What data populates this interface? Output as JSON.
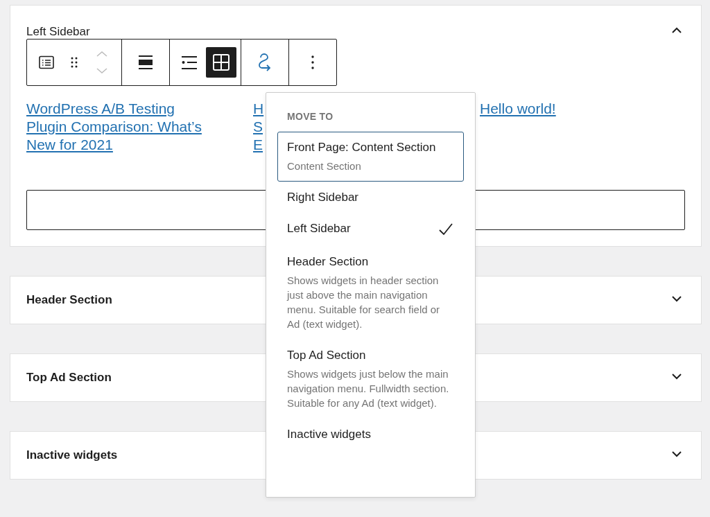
{
  "areas": [
    {
      "title": "Left Sidebar",
      "expanded": true
    },
    {
      "title": "Header Section",
      "expanded": false
    },
    {
      "title": "Top Ad Section",
      "expanded": false
    },
    {
      "title": "Inactive widgets",
      "expanded": false
    }
  ],
  "toolbar": [
    [
      {
        "kind": "list-view",
        "selected": false
      },
      {
        "kind": "drag",
        "selected": false
      },
      {
        "kind": "movers",
        "selected": false
      }
    ],
    [
      {
        "kind": "align",
        "selected": false
      }
    ],
    [
      {
        "kind": "list-layout",
        "selected": false
      },
      {
        "kind": "grid-layout",
        "selected": true
      }
    ],
    [
      {
        "kind": "move-to",
        "selected": false
      }
    ],
    [
      {
        "kind": "more",
        "selected": false
      }
    ]
  ],
  "links": [
    [
      "WordPress A/B Testing",
      "Plugin Comparison: What’s",
      "New for 2021"
    ],
    [
      "H",
      "S",
      "E"
    ],
    [
      "Hello world!"
    ]
  ],
  "menu": {
    "heading": "MOVE TO",
    "items": [
      {
        "label": "Front Page: Content Section",
        "description": "Content Section",
        "focused": true,
        "checked": false
      },
      {
        "label": "Right Sidebar",
        "focused": false,
        "checked": false
      },
      {
        "label": "Left Sidebar",
        "focused": false,
        "checked": true
      },
      {
        "label": "Header Section",
        "description": "Shows widgets in header section just above the main navigation menu. Suitable for search field or Ad (text widget).",
        "focused": false,
        "checked": false
      },
      {
        "label": "Top Ad Section",
        "description": "Shows widgets just below the main navigation menu. Fullwidth section. Suitable for any Ad (text widget).",
        "focused": false,
        "checked": false
      },
      {
        "label": "Inactive widgets",
        "focused": false,
        "checked": false
      }
    ]
  }
}
